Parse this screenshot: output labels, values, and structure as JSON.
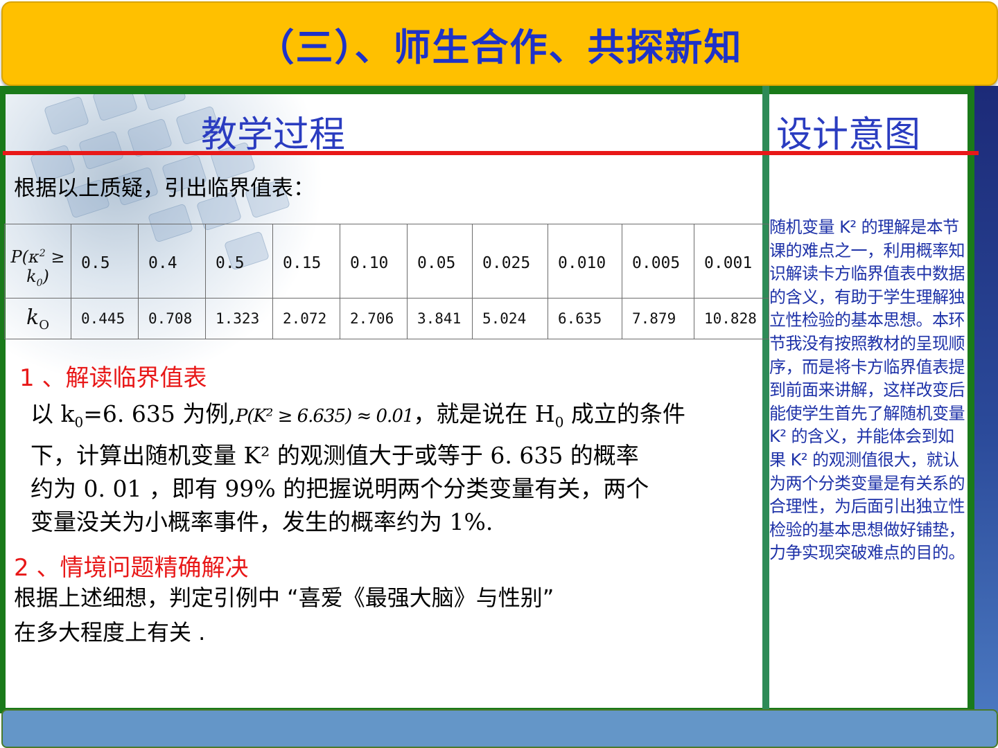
{
  "banner": {
    "title": "（三）、师生合作、共探新知"
  },
  "main": {
    "heading": "教学过程",
    "intro": "根据以上质疑，引出临界值表：",
    "table": {
      "row_p_header": {
        "P": "P(κ",
        "sup": "2",
        "mid": " ≥ k",
        "sub": "0",
        "end": ")"
      },
      "row_k_header": {
        "k": "k",
        "sub": "O"
      },
      "p_values": [
        "0.5",
        "0.4",
        "0.5",
        "0.15",
        "0.10",
        "0.05",
        "0.025",
        "0.010",
        "0.005",
        "0.001"
      ],
      "k_values": [
        "0.445",
        "0.708",
        "1.323",
        "2.072",
        "2.706",
        "3.841",
        "5.024",
        "6.635",
        "7.879",
        "10.828"
      ]
    },
    "section1": {
      "title": "1 、解读临界值表",
      "line1_a": "以 k",
      "line1_sub": "0",
      "line1_b": "=6. 635 为例,",
      "formula": "P(K² ≥ 6.635) ≈ 0.01",
      "line1_c": "，就是说在 H",
      "line1_sub2": "0",
      "line1_d": " 成立的条件",
      "line2": "下，计算出随机变量 K² 的观测值大于或等于 6. 635 的概率",
      "line3": "约为 0. 01 ，即有 99% 的把握说明两个分类变量有关，两个",
      "line4": "变量没关为小概率事件，发生的概率约为 1%."
    },
    "section2": {
      "title": "2 、情境问题精确解决",
      "line1": "根据上述细想，判定引例中 “喜爱《最强大脑》与性别”",
      "line2": "在多大程度上有关 ."
    }
  },
  "side": {
    "heading": "设计意图",
    "text": "随机变量 K² 的理解是本节课的难点之一，利用概率知识解读卡方临界值表中数据的含义，有助于学生理解独立性检验的基本思想。本环节我没有按照教材的呈现顺序，而是将卡方临界值表提到前面来讲解，这样改变后能使学生首先了解随机变量 K² 的含义，并能体会到如果 K² 的观测值很大，就认为两个分类变量是有关系的合理性，为后面引出独立性检验的基本思想做好铺垫，力争实现突破难点的目的。"
  },
  "colors": {
    "banner_bg": "#ffc000",
    "title_blue": "#1e32c8",
    "frame_green": "#1a7a1a",
    "accent_red": "#e81818",
    "bottom_blue": "#6496c8"
  }
}
